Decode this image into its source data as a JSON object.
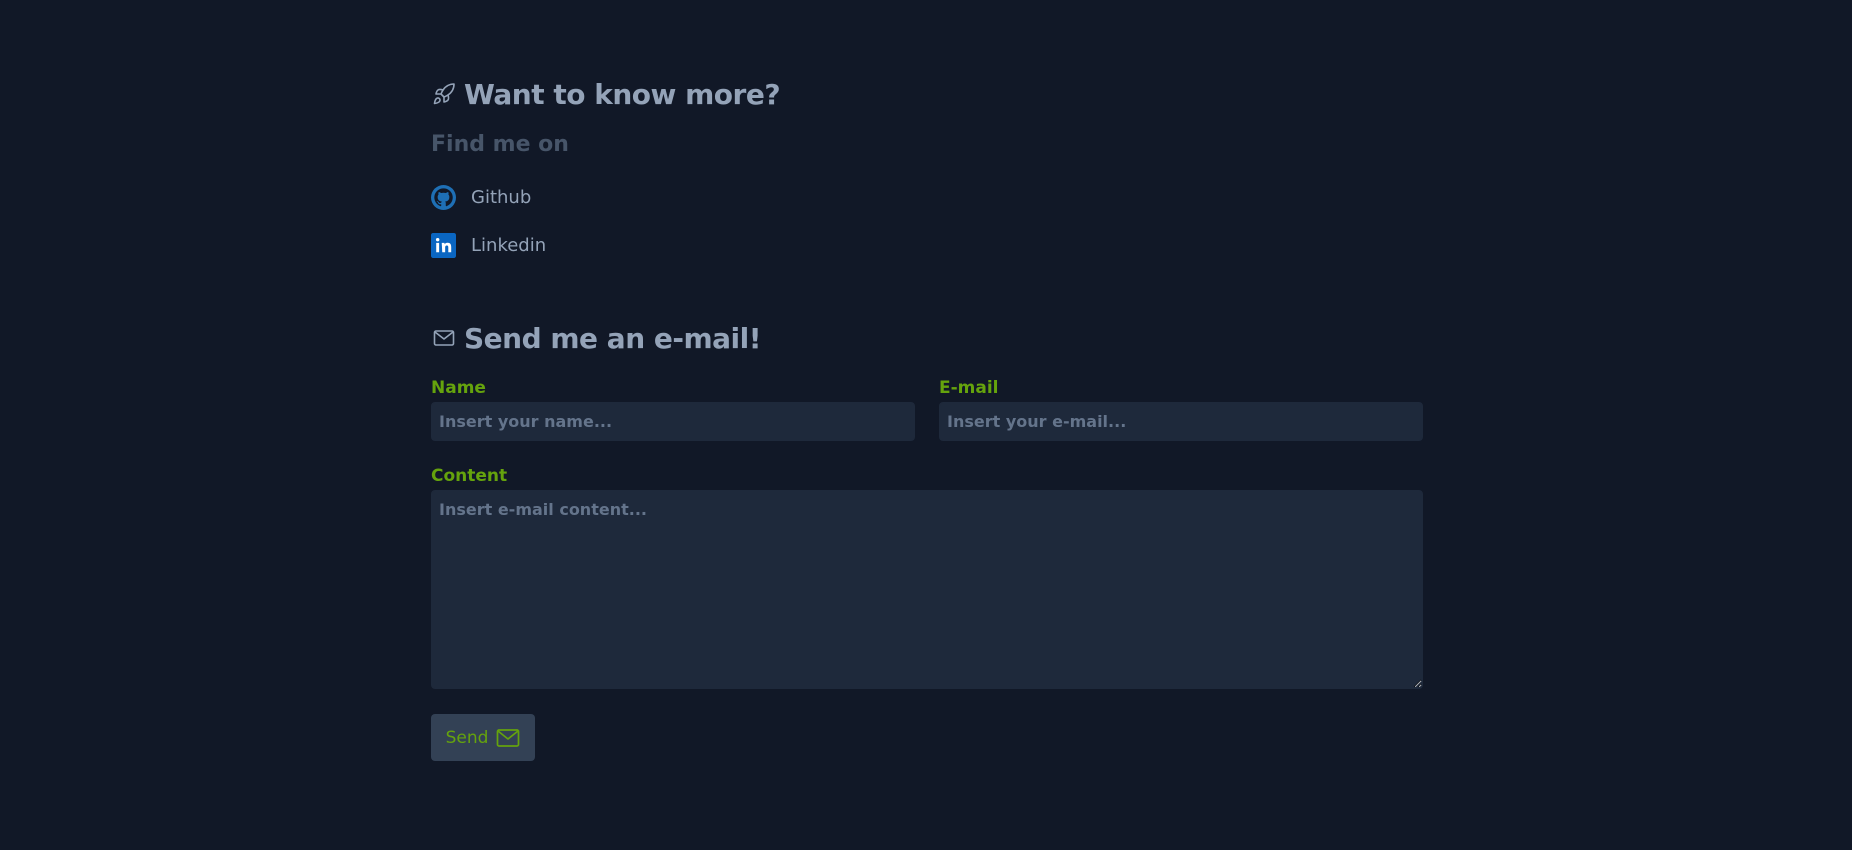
{
  "colors": {
    "background": "#111827",
    "heading": "#94a3b8",
    "subtitle": "#475569",
    "label": "#65a30d",
    "input_bg": "#1e293b",
    "button_bg": "#334155",
    "github_blue": "#1e6fb5",
    "linkedin_blue": "#0a66c2"
  },
  "social_section": {
    "title": "Want to know more?",
    "title_icon": "rocket-icon",
    "subtitle": "Find me on",
    "links": [
      {
        "label": "Github",
        "icon": "github-icon"
      },
      {
        "label": "Linkedin",
        "icon": "linkedin-icon"
      }
    ]
  },
  "email_section": {
    "title": "Send me an e-mail!",
    "title_icon": "envelope-icon",
    "fields": {
      "name": {
        "label": "Name",
        "placeholder": "Insert your name...",
        "value": ""
      },
      "email": {
        "label": "E-mail",
        "placeholder": "Insert your e-mail...",
        "value": ""
      },
      "content": {
        "label": "Content",
        "placeholder": "Insert e-mail content...",
        "value": ""
      }
    },
    "send_button": {
      "label": "Send",
      "icon": "envelope-icon"
    }
  }
}
